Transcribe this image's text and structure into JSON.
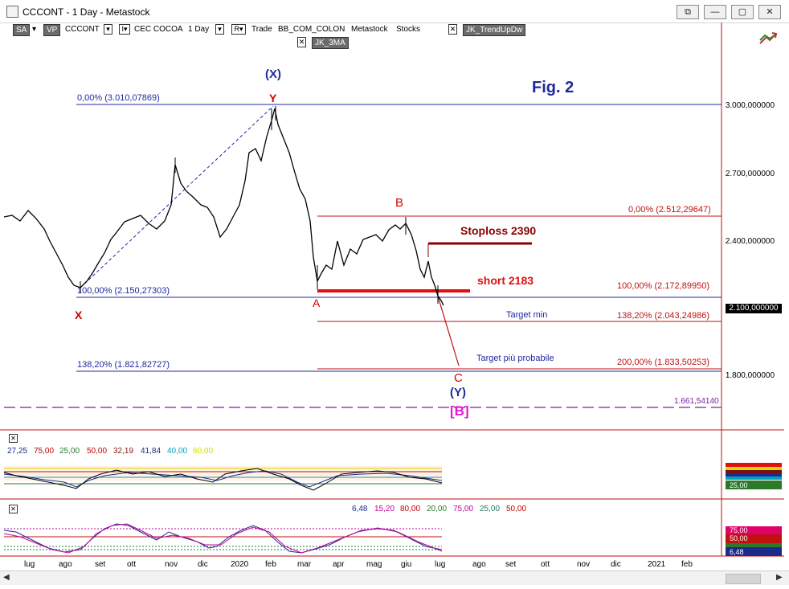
{
  "window": {
    "title": "CCCONT - 1 Day - Metastock",
    "buttons": [
      "⧉",
      "—",
      "▢",
      "✕"
    ]
  },
  "toolbar": {
    "sa": "SA",
    "sa_arrow": "▾",
    "vp": "VP",
    "symbol": "CCCONT",
    "symbol_arrow": "▾",
    "lock": "I▾",
    "name": "CEC COCOA",
    "period": "1 Day",
    "period_arrow": "▾",
    "r_btn": "R▾",
    "trade": "Trade",
    "template": "BB_COM_COLON",
    "app": "Metastock",
    "section": "Stocks",
    "close1": "✕",
    "indicator1": "JK_TrendUpDw",
    "close2": "✕",
    "indicator2": "JK_3MA"
  },
  "price_axis": {
    "labels": [
      "3.000,000000",
      "2.700,000000",
      "2.400,000000",
      "1.800,000000"
    ],
    "current": "2.100,000000",
    "extra": "1.661,54140"
  },
  "annotations": {
    "fig": "Fig. 2",
    "wave_X_paren": "(X)",
    "wave_Y_top": "Y",
    "wave_X": "X",
    "wave_A": "A",
    "wave_B": "B",
    "wave_C": "C",
    "wave_Y_paren": "(Y)",
    "wave_B_bracket": "[B]",
    "stoploss": "Stoploss 2390",
    "short": "short 2183",
    "target_min": "Target min",
    "target_prob": "Target più probabile"
  },
  "fib_levels": {
    "left_0": "0,00% (3.010,07869)",
    "left_100": "100,00% (2.150,27303)",
    "left_138": "138,20% (1.821,82727)",
    "right_0": "0,00% (2.512,29647)",
    "right_100": "100,00% (2.172,89950)",
    "right_138": "138,20% (2.043,24986)",
    "right_200": "200,00% (1.833,50253)"
  },
  "indicator1": {
    "values": [
      "27,25",
      "75,00",
      "25,00",
      "50,00",
      "32,19",
      "41,84",
      "40,00",
      "60,00"
    ],
    "colors": [
      "#1c2a8c",
      "#c00000",
      "#2a7a2a",
      "#c00000",
      "#8b1a1a",
      "#1c2a8c",
      "#00a0c0",
      "#d8d800"
    ],
    "badge_last": "25,00"
  },
  "indicator2": {
    "values": [
      "6,48",
      "15,20",
      "80,00",
      "20,00",
      "75,00",
      "25,00",
      "50,00"
    ],
    "colors": [
      "#1c2a8c",
      "#c0009a",
      "#c00000",
      "#2a7a2a",
      "#c0009a",
      "#1c7a5a",
      "#c00000"
    ],
    "badges": [
      "75,00",
      "50,00",
      "6,48"
    ]
  },
  "x_axis": [
    "lug",
    "ago",
    "set",
    "ott",
    "nov",
    "dic",
    "2020",
    "feb",
    "mar",
    "apr",
    "mag",
    "giu",
    "lug",
    "ago",
    "set",
    "ott",
    "nov",
    "dic",
    "2021",
    "feb"
  ],
  "colors": {
    "fib_blue": "#1e2a9c",
    "wave_red": "#d40000",
    "wave_blue": "#1e2a9c",
    "magenta": "#e01ad0",
    "dark_red": "#8b0000"
  }
}
